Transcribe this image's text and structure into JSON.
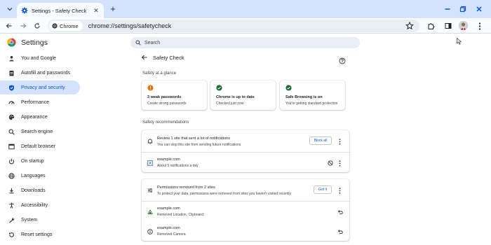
{
  "tab": {
    "title": "Settings - Safety Check",
    "close_icon": "close-icon"
  },
  "omnibox": {
    "chip_label": "Chrome",
    "url": "chrome://settings/safetycheck"
  },
  "settings": {
    "title": "Settings",
    "search_placeholder": "Search"
  },
  "sidebar": {
    "items": [
      {
        "label": "You and Google",
        "icon": "person-icon"
      },
      {
        "label": "Autofill and passwords",
        "icon": "clipboard-icon"
      },
      {
        "label": "Privacy and security",
        "icon": "shield-icon",
        "active": true
      },
      {
        "label": "Performance",
        "icon": "speedometer-icon"
      },
      {
        "label": "Appearance",
        "icon": "palette-icon"
      },
      {
        "label": "Search engine",
        "icon": "search-icon"
      },
      {
        "label": "Default browser",
        "icon": "browser-icon"
      },
      {
        "label": "On startup",
        "icon": "power-icon"
      },
      {
        "label": "Languages",
        "icon": "globe-icon"
      },
      {
        "label": "Downloads",
        "icon": "download-icon"
      },
      {
        "label": "Accessibility",
        "icon": "accessibility-icon"
      },
      {
        "label": "System",
        "icon": "wrench-icon"
      },
      {
        "label": "Reset settings",
        "icon": "reset-icon"
      }
    ]
  },
  "main": {
    "page_title": "Safety Check",
    "glance_label": "Safety at a glance",
    "glance": [
      {
        "title": "3 weak passwords",
        "subtitle": "Create strong passwords",
        "status": "warning",
        "color": "#e37400"
      },
      {
        "title": "Chrome is up to date",
        "subtitle": "Checked just now",
        "status": "ok",
        "color": "#146c2e"
      },
      {
        "title": "Safe Browsing is on",
        "subtitle": "You're getting standard protection",
        "status": "ok",
        "color": "#146c2e"
      }
    ],
    "recommendations_label": "Safety recommendations",
    "notifications": {
      "title": "Review 1 site that sent a lot of notifications",
      "subtitle": "You can stop this site from sending future notifications",
      "button": "Block all",
      "site": "example.com",
      "site_detail": "About 5 notifications a day"
    },
    "permissions": {
      "title": "Permissions removed from 2 sites",
      "subtitle": "To protect your data, permissions were removed from sites you haven't visited recently",
      "button": "Got it",
      "sites": [
        {
          "site": "example.com",
          "detail": "Removed Location, Clipboard"
        },
        {
          "site": "example.com",
          "detail": "Removed Camera"
        }
      ]
    }
  },
  "colors": {
    "accent": "#0b57d0",
    "tabstrip": "#d3e3fd",
    "active_nav": "#d3e3fd"
  }
}
